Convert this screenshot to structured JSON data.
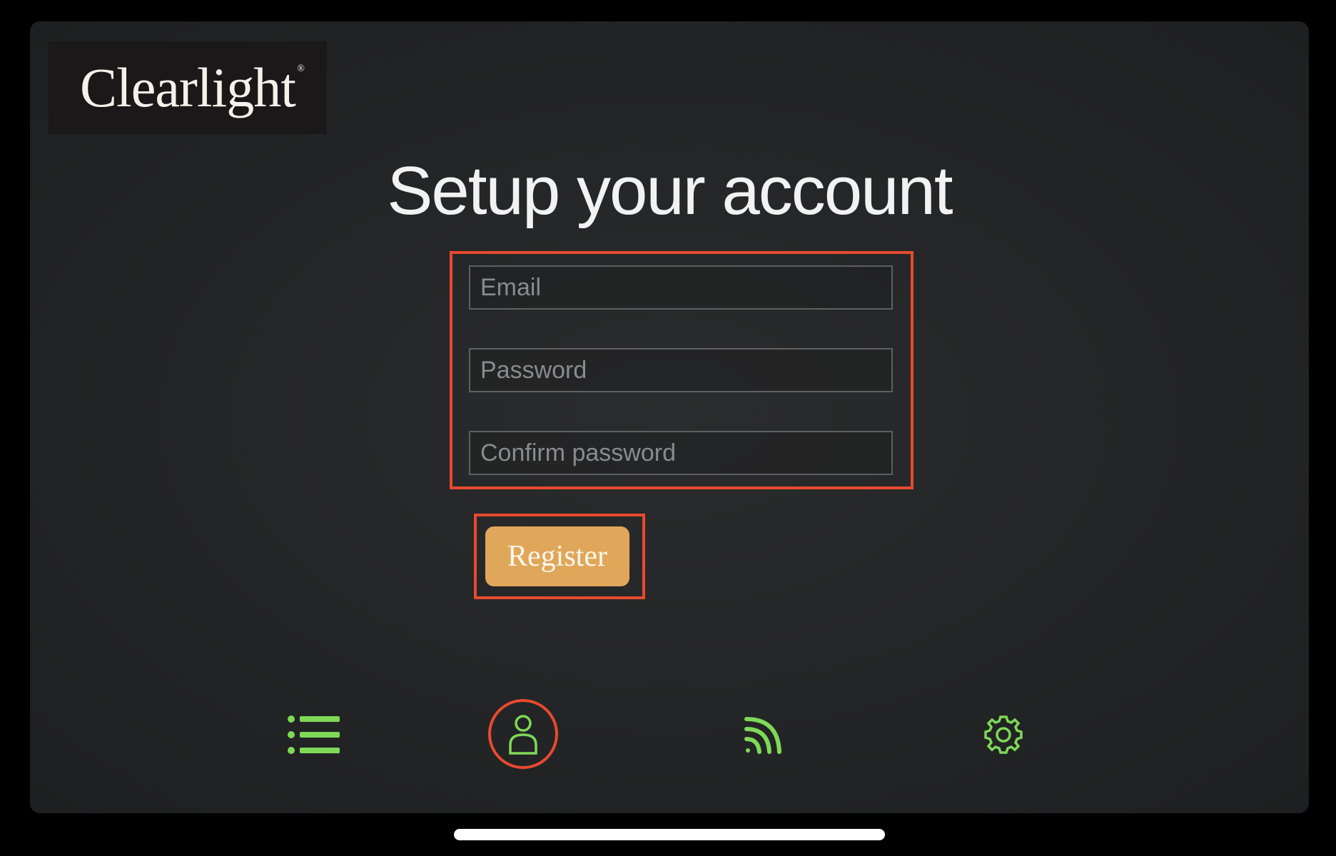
{
  "app": {
    "brand": "Clearlight",
    "brand_mark": "®"
  },
  "page": {
    "title": "Setup your account"
  },
  "form": {
    "email_placeholder": "Email",
    "password_placeholder": "Password",
    "confirm_placeholder": "Confirm password",
    "register_label": "Register"
  },
  "nav": {
    "items": [
      {
        "icon": "list-icon"
      },
      {
        "icon": "user-icon",
        "active": true
      },
      {
        "icon": "wifi-icon"
      },
      {
        "icon": "gear-icon"
      }
    ]
  },
  "colors": {
    "accent_green": "#7ed957",
    "button_gold": "#e0a75a",
    "highlight_red": "#e84a30"
  }
}
